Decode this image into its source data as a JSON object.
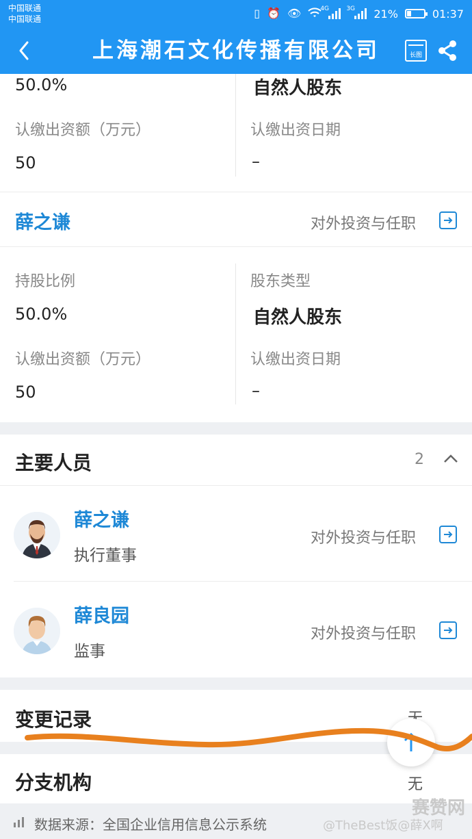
{
  "status_bar": {
    "carrier_1": "中国联通",
    "carrier_2": "中国联通",
    "sig1_type": "4G",
    "sig2_type": "3G",
    "battery": "21%",
    "battery_level": 0.21,
    "time": "01:37"
  },
  "nav": {
    "title": "上海潮石文化传播有限公司",
    "long_image_label": "长图"
  },
  "shareholder_prev": {
    "ratio": "50.0%",
    "type": "自然人股东",
    "amount_label": "认缴出资额（万元）",
    "amount": "50",
    "date_label": "认缴出资日期",
    "date": "–"
  },
  "shareholder": {
    "name": "薛之谦",
    "link": "对外投资与任职",
    "ratio_label": "持股比例",
    "ratio": "50.0%",
    "type_label": "股东类型",
    "type": "自然人股东",
    "amount_label": "认缴出资额（万元）",
    "amount": "50",
    "date_label": "认缴出资日期",
    "date": "–"
  },
  "key_personnel": {
    "title": "主要人员",
    "count": "2",
    "people": [
      {
        "name": "薛之谦",
        "role": "执行董事",
        "link": "对外投资与任职"
      },
      {
        "name": "薛良园",
        "role": "监事",
        "link": "对外投资与任职"
      }
    ]
  },
  "change_records": {
    "title": "变更记录",
    "value": "无"
  },
  "branches": {
    "title": "分支机构",
    "value": "无"
  },
  "footer": {
    "source": "数据来源：全国企业信用信息公示系统",
    "watermark_weibo": "@TheBest饭@薛X啊",
    "watermark_site": "赛赞网"
  },
  "colors": {
    "primary": "#2196f3",
    "link_blue": "#1e88d6",
    "annotation_orange": "#e8801e"
  }
}
